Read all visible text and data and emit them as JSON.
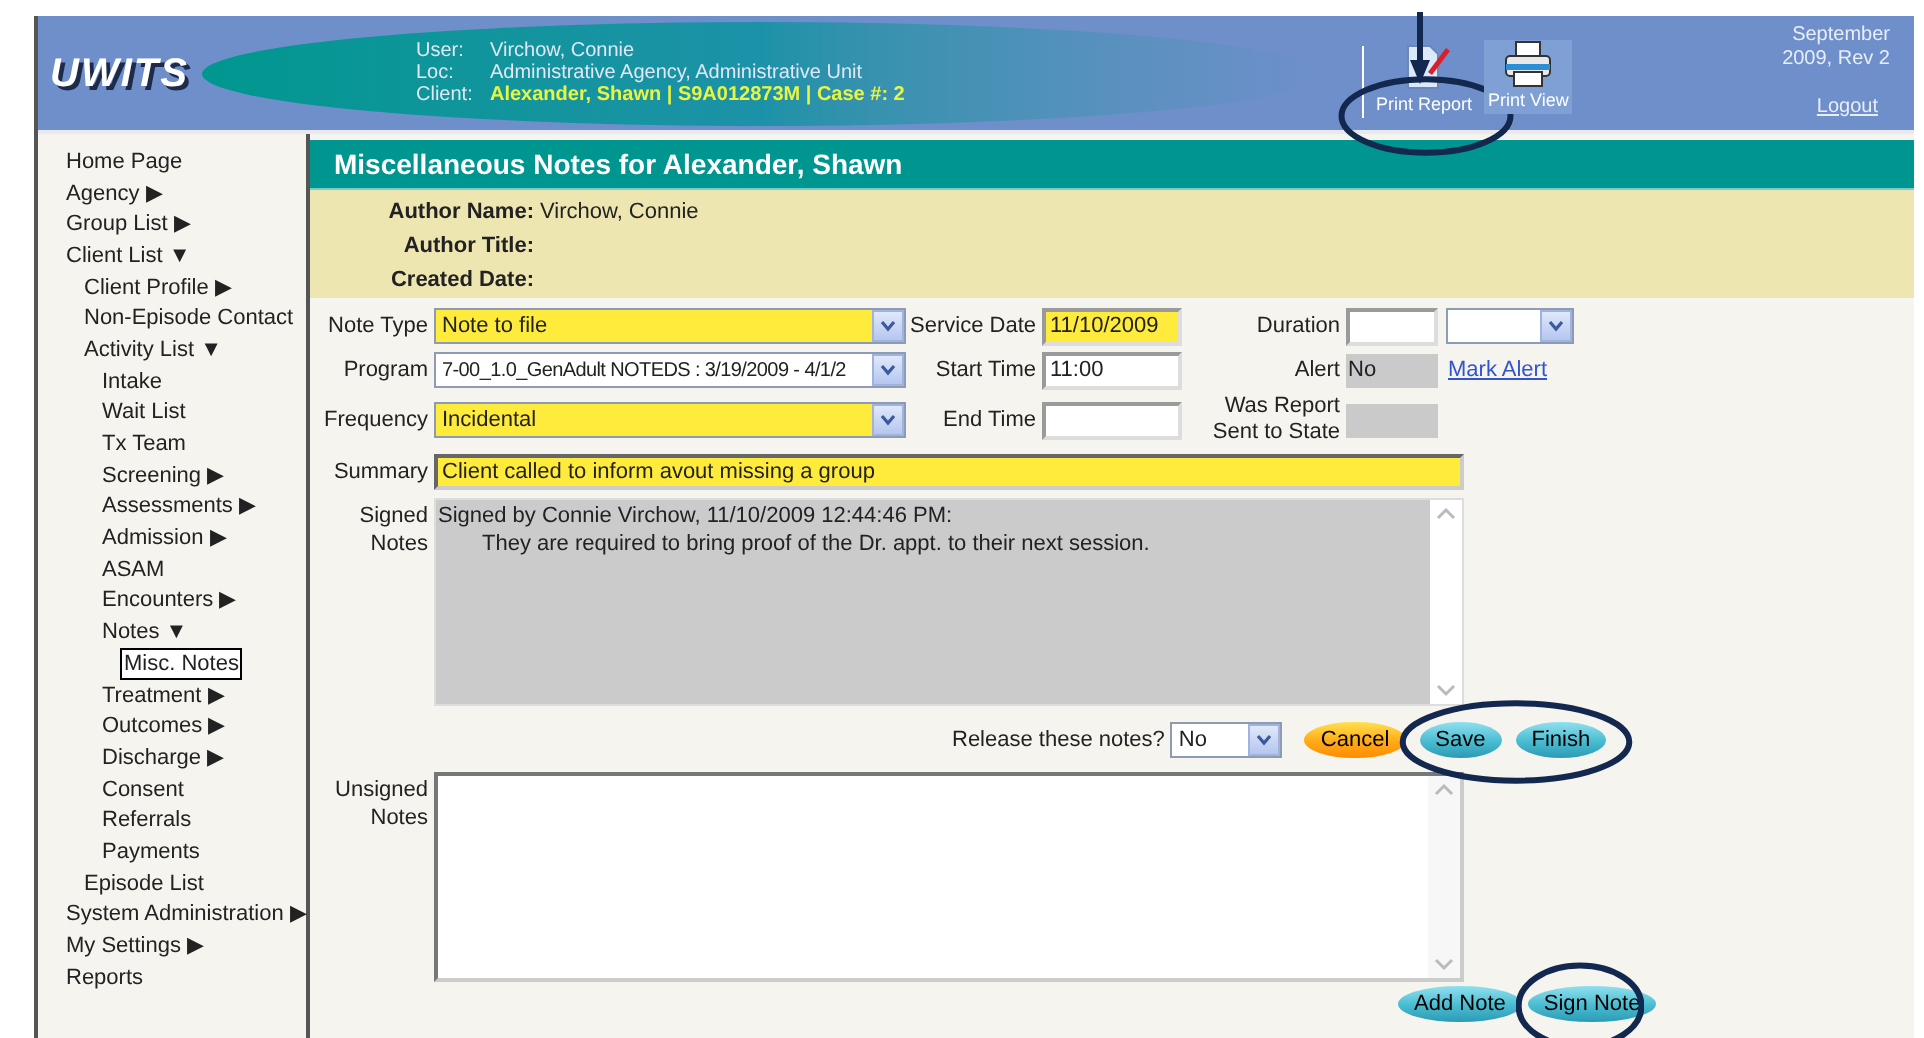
{
  "header": {
    "logo": "UWITS",
    "info": [
      {
        "label": "User:",
        "value": "Virchow, Connie",
        "highlight": false
      },
      {
        "label": "Loc:",
        "value": "Administrative Agency, Administrative Unit",
        "highlight": false
      },
      {
        "label": "Client:",
        "value": "Alexander, Shawn | S9A012873M | Case #: 2",
        "highlight": true
      }
    ],
    "tools": [
      {
        "label": "Print Report",
        "kind": "report",
        "circled": true,
        "pointer": true
      },
      {
        "label": "Print View",
        "kind": "printer",
        "circled": false,
        "pointer": false
      }
    ],
    "version": "September 2009, Rev 2",
    "logout": "Logout"
  },
  "sidebar": {
    "items": [
      {
        "label": "Home Page",
        "selected": false
      },
      {
        "label": "Agency",
        "arrow": "▶",
        "selected": false
      },
      {
        "label": "Group List",
        "arrow": "▶",
        "selected": false
      },
      {
        "label": "Client List",
        "arrow": "▼",
        "selected": false,
        "children": [
          {
            "label": "Client Profile",
            "arrow": "▶",
            "selected": false
          },
          {
            "label": "Non-Episode Contact",
            "selected": false
          },
          {
            "label": "Activity List",
            "arrow": "▼",
            "selected": false,
            "children": [
              {
                "label": "Intake",
                "selected": false
              },
              {
                "label": "Wait List",
                "selected": false
              },
              {
                "label": "Tx Team",
                "selected": false
              },
              {
                "label": "Screening",
                "arrow": "▶",
                "selected": false
              },
              {
                "label": "Assessments",
                "arrow": "▶",
                "selected": false
              },
              {
                "label": "Admission",
                "arrow": "▶",
                "selected": false
              },
              {
                "label": "ASAM",
                "selected": false
              },
              {
                "label": "Encounters",
                "arrow": "▶",
                "selected": false
              },
              {
                "label": "Notes",
                "arrow": "▼",
                "selected": false,
                "children": [
                  {
                    "label": "Misc. Notes",
                    "selected": true
                  }
                ]
              },
              {
                "label": "Treatment",
                "arrow": "▶",
                "selected": false
              },
              {
                "label": "Outcomes",
                "arrow": "▶",
                "selected": false
              },
              {
                "label": "Discharge",
                "arrow": "▶",
                "selected": false
              },
              {
                "label": "Consent",
                "selected": false
              },
              {
                "label": "Referrals",
                "selected": false
              },
              {
                "label": "Payments",
                "selected": false
              }
            ]
          },
          {
            "label": "Episode List",
            "selected": false
          }
        ]
      },
      {
        "label": "System Administration",
        "arrow": "▶",
        "selected": false
      },
      {
        "label": "My Settings",
        "arrow": "▶",
        "selected": false
      },
      {
        "label": "Reports",
        "selected": false
      }
    ]
  },
  "page": {
    "title": "Miscellaneous Notes for Alexander, Shawn",
    "author": [
      {
        "label": "Author Name:",
        "value": "Virchow, Connie"
      },
      {
        "label": "Author Title:"
      },
      {
        "label": "Created Date:"
      }
    ],
    "rows": [
      [
        {
          "label": "Note Type",
          "kind": "select",
          "value": "Note to file",
          "required": true
        },
        {
          "label": "Service Date",
          "kind": "text",
          "value": "11/10/2009",
          "required": true
        },
        {
          "label": "Duration",
          "kind": "text",
          "required": false
        },
        {
          "kind": "select",
          "required": false
        }
      ],
      [
        {
          "label": "Program",
          "kind": "select",
          "value": "7-00_1.0_GenAdult NOTEDS : 3/19/2009 - 4/1/2",
          "required": false
        },
        {
          "label": "Start Time",
          "kind": "text",
          "value": "11:00",
          "required": false
        },
        {
          "label": "Alert",
          "kind": "readonly",
          "value": "No"
        },
        {
          "kind": "link",
          "value": "Mark Alert"
        }
      ],
      [
        {
          "label": "Frequency",
          "kind": "select",
          "value": "Incidental",
          "required": true
        },
        {
          "label": "End Time",
          "kind": "text",
          "required": false
        },
        {
          "label": "Was Report Sent to State",
          "kind": "readonly"
        }
      ]
    ],
    "summary": {
      "label": "Summary",
      "value": "Client called to inform avout missing a group",
      "required": true
    },
    "signed": {
      "label": "Signed Notes",
      "lines": [
        "Signed by Connie Virchow, 11/10/2009 12:44:46 PM:",
        "They are required to bring proof of the Dr. appt. to their next session."
      ]
    },
    "release": {
      "label": "Release these notes?",
      "value": "No"
    },
    "actions": [
      {
        "label": "Cancel",
        "kind": "cancel",
        "circled": false
      },
      {
        "label": "Save",
        "kind": "confirm",
        "circled": true
      },
      {
        "label": "Finish",
        "kind": "confirm",
        "circled": true
      }
    ],
    "unsigned": {
      "label": "Unsigned Notes"
    },
    "note_actions": [
      {
        "label": "Add Note",
        "circled": false
      },
      {
        "label": "Sign Note",
        "circled": true
      }
    ]
  }
}
